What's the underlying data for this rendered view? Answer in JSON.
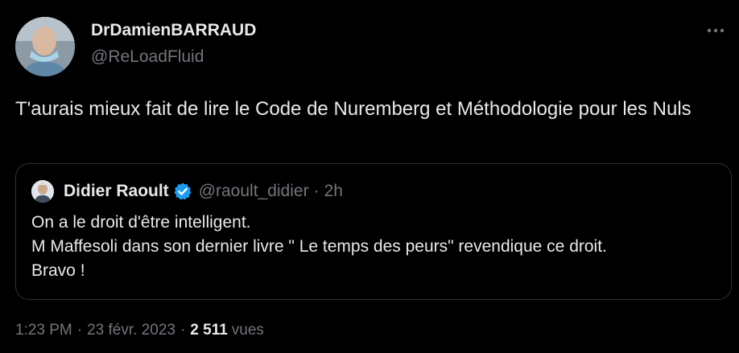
{
  "author": {
    "display_name": "DrDamienBARRAUD",
    "handle": "@ReLoadFluid"
  },
  "tweet": {
    "text": "T'aurais mieux fait de lire le Code de Nuremberg et Méthodologie pour les Nuls"
  },
  "quoted_tweet": {
    "display_name": "Didier Raoult",
    "handle": "@raoult_didier",
    "separator": "·",
    "time": "2h",
    "lines": [
      "On a le droit d'être intelligent.",
      "M Maffesoli dans son dernier livre \" Le temps des peurs\" revendique ce droit.",
      "Bravo !"
    ]
  },
  "meta": {
    "time": "1:23 PM",
    "separator": "·",
    "date": "23 févr. 2023",
    "views_count": "2 511",
    "views_label": "vues"
  },
  "icons": {
    "more": "more-dots-icon",
    "verified": "verified-badge-icon"
  },
  "colors": {
    "background": "#000000",
    "text_primary": "#e7e9ea",
    "text_secondary": "#71767b",
    "border": "#2f3336",
    "verified_blue": "#1d9bf0"
  }
}
